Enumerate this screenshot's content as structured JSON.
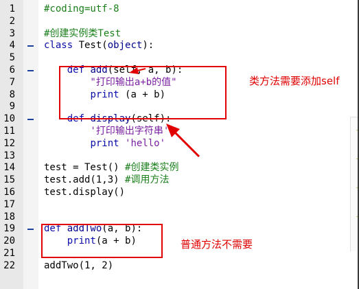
{
  "editor": {
    "lines": [
      {
        "n": "1",
        "fold": false,
        "tokens": [
          {
            "t": "#coding=utf-8",
            "c": "cm"
          }
        ]
      },
      {
        "n": "2",
        "fold": false,
        "tokens": []
      },
      {
        "n": "3",
        "fold": false,
        "tokens": [
          {
            "t": "#创建实例类Test",
            "c": "cm"
          }
        ]
      },
      {
        "n": "4",
        "fold": true,
        "tokens": [
          {
            "t": "class ",
            "c": "kw"
          },
          {
            "t": "Test(",
            "c": ""
          },
          {
            "t": "object",
            "c": "obj"
          },
          {
            "t": "):",
            "c": ""
          }
        ]
      },
      {
        "n": "5",
        "fold": false,
        "tokens": []
      },
      {
        "n": "6",
        "fold": true,
        "tokens": [
          {
            "t": "    def ",
            "c": "kw"
          },
          {
            "t": "add",
            "c": "obj"
          },
          {
            "t": "(self, a, b):",
            "c": ""
          }
        ]
      },
      {
        "n": "7",
        "fold": false,
        "tokens": [
          {
            "t": "        \"打印输出a+b的值\"",
            "c": "str"
          }
        ]
      },
      {
        "n": "8",
        "fold": false,
        "tokens": [
          {
            "t": "        ",
            "c": ""
          },
          {
            "t": "print",
            "c": "kw"
          },
          {
            "t": " (a + b)",
            "c": ""
          }
        ]
      },
      {
        "n": "9",
        "fold": false,
        "tokens": []
      },
      {
        "n": "10",
        "fold": true,
        "tokens": [
          {
            "t": "    def ",
            "c": "kw"
          },
          {
            "t": "display",
            "c": "obj"
          },
          {
            "t": "(self):",
            "c": ""
          }
        ]
      },
      {
        "n": "11",
        "fold": false,
        "tokens": [
          {
            "t": "        '打印输出字符串'",
            "c": "str"
          }
        ]
      },
      {
        "n": "12",
        "fold": false,
        "tokens": [
          {
            "t": "        ",
            "c": ""
          },
          {
            "t": "print",
            "c": "kw"
          },
          {
            "t": " ",
            "c": ""
          },
          {
            "t": "'hello'",
            "c": "str"
          }
        ]
      },
      {
        "n": "13",
        "fold": false,
        "tokens": []
      },
      {
        "n": "14",
        "fold": false,
        "tokens": [
          {
            "t": "test = Test() ",
            "c": ""
          },
          {
            "t": "#创建类实例",
            "c": "cm"
          }
        ]
      },
      {
        "n": "15",
        "fold": false,
        "tokens": [
          {
            "t": "test.add(1,3) ",
            "c": ""
          },
          {
            "t": "#调用方法",
            "c": "cm"
          }
        ]
      },
      {
        "n": "16",
        "fold": false,
        "tokens": [
          {
            "t": "test.display()",
            "c": ""
          }
        ]
      },
      {
        "n": "17",
        "fold": false,
        "tokens": []
      },
      {
        "n": "18",
        "fold": false,
        "tokens": []
      },
      {
        "n": "19",
        "fold": true,
        "tokens": [
          {
            "t": "def ",
            "c": "kw"
          },
          {
            "t": "addTwo",
            "c": "obj"
          },
          {
            "t": "(a, b):",
            "c": ""
          }
        ]
      },
      {
        "n": "20",
        "fold": false,
        "tokens": [
          {
            "t": "    ",
            "c": ""
          },
          {
            "t": "print",
            "c": "kw"
          },
          {
            "t": "(a + b)",
            "c": ""
          }
        ]
      },
      {
        "n": "21",
        "fold": false,
        "tokens": []
      },
      {
        "n": "22",
        "fold": false,
        "tokens": [
          {
            "t": "addTwo(1, 2)",
            "c": ""
          }
        ]
      }
    ]
  },
  "annotations": {
    "class_method_note": "类方法需要添加self",
    "plain_function_note": "普通方法不需要"
  },
  "colors": {
    "annotation_red": "#e00000",
    "keyword_blue": "#0a0aa8",
    "comment_green": "#1a7f1a",
    "string_purple": "#7a1fa0"
  }
}
